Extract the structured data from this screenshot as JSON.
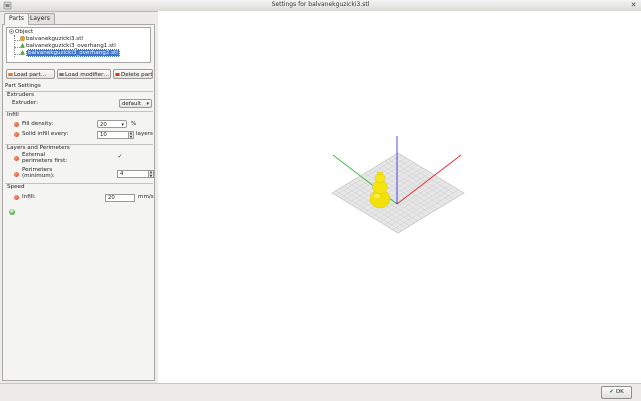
{
  "window": {
    "title": "Settings for balvanekguzicki3.stl",
    "close_glyph": "✕"
  },
  "tabs": [
    {
      "label": "Parts"
    },
    {
      "label": "Layers"
    }
  ],
  "tree": {
    "root": "Object",
    "items": [
      {
        "label": "balvanekguzicki3.stl",
        "icon": "part-icon"
      },
      {
        "label": "balvanekguzicki3_overhang1.stl",
        "icon": "modifier-icon"
      },
      {
        "label": "balvanekguzicki3_overhang2.stl",
        "icon": "modifier-icon",
        "selected": true
      }
    ]
  },
  "buttons": {
    "load_part": "Load part…",
    "load_modifier": "Load modifier…",
    "delete_part": "Delete part"
  },
  "settings": {
    "heading": "Part Settings",
    "extruders": {
      "header": "Extruders",
      "label": "Extruder:",
      "value": "default"
    },
    "infill": {
      "header": "Infill",
      "fill_density_label": "Fill density:",
      "fill_density_value": "20",
      "fill_density_unit": "%",
      "solid_every_label": "Solid infill every:",
      "solid_every_value": "10",
      "solid_every_unit": "layers"
    },
    "layers": {
      "header": "Layers and Perimeters",
      "ext_first_label_1": "External",
      "ext_first_label_2": "perimeters first:",
      "ext_first_checked": "✓",
      "perimeters_label_1": "Perimeters",
      "perimeters_label_2": "(minimum):",
      "perimeters_value": "4"
    },
    "speed": {
      "header": "Speed",
      "infill_label": "Infill:",
      "infill_value": "20",
      "infill_unit": "mm/s"
    }
  },
  "add_setting_glyph": "+",
  "footer": {
    "ok_label": "OK"
  },
  "colors": {
    "axis_x": "#e8202a",
    "axis_y": "#2fb32f",
    "axis_z": "#2323d8",
    "model": "#f2e00a",
    "selection": "#3e73c8"
  }
}
